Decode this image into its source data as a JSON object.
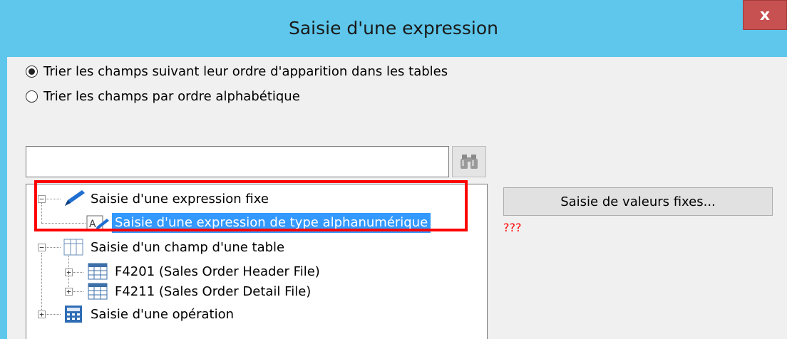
{
  "dialog": {
    "title": "Saisie d'une expression",
    "close_label": "x"
  },
  "sort_options": [
    {
      "label": "Trier les champs suivant leur ordre d'apparition dans les tables",
      "checked": true
    },
    {
      "label": "Trier les champs par ordre alphabétique",
      "checked": false
    }
  ],
  "search": {
    "value": "",
    "button_icon": "binoculars-icon"
  },
  "tree": {
    "nodes": [
      {
        "label": "Saisie d'une expression fixe",
        "icon": "pencil-icon",
        "expander": "minus"
      },
      {
        "label": "Saisie d'une expression de type alphanumérique",
        "icon": "alpha-edit-icon",
        "selected": true
      },
      {
        "label": "Saisie d'un champ d'une table",
        "icon": "table-columns-icon",
        "expander": "minus"
      },
      {
        "label": "F4201 (Sales Order Header File)",
        "icon": "table-grid-icon",
        "expander": "plus"
      },
      {
        "label": "F4211 (Sales Order Detail File)",
        "icon": "table-grid-icon",
        "expander": "plus"
      },
      {
        "label": "Saisie d'une opération",
        "icon": "calculator-icon",
        "expander": "plus"
      }
    ]
  },
  "fixed_values_button": "Saisie de valeurs fixes...",
  "annotation": "???",
  "colors": {
    "titlebar": "#5ec7eb",
    "close": "#c75050",
    "selection": "#3399ff",
    "highlight": "#ff0000"
  }
}
